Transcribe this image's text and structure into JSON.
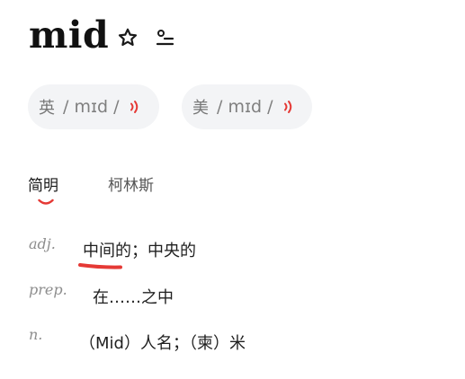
{
  "word": {
    "text": "mid",
    "favorite_icon": "star-outline-icon",
    "wordbook_icon": "add-to-wordbook-icon"
  },
  "pronunciations": [
    {
      "region": "英",
      "ipa": "/ mɪd /",
      "speaker_icon": "speaker-icon"
    },
    {
      "region": "美",
      "ipa": "/ mɪd /",
      "speaker_icon": "speaker-icon"
    }
  ],
  "tabs": [
    {
      "label": "简明",
      "active": true
    },
    {
      "label": "柯林斯",
      "active": false
    }
  ],
  "definitions": [
    {
      "pos": "adj.",
      "meaning": "中间的；中央的"
    },
    {
      "pos": "prep.",
      "meaning": "在……之中"
    },
    {
      "pos": "n.",
      "meaning": "（Mid）人名；（柬）米"
    }
  ],
  "colors": {
    "accent_red": "#e53935",
    "pill_background": "#f3f4f6",
    "muted_text": "#8d8d8d"
  }
}
